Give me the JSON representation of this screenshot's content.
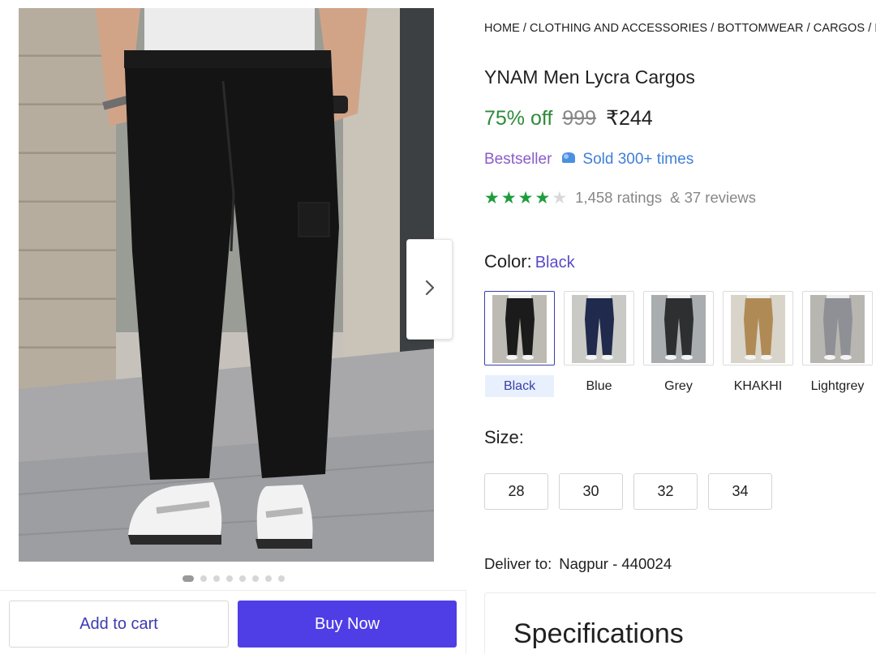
{
  "gallery": {
    "dot_count": 8,
    "active_dot": 0,
    "next_icon": "chevron-right-icon"
  },
  "actions": {
    "add_to_cart": "Add to cart",
    "buy_now": "Buy Now"
  },
  "breadcrumb": {
    "items": [
      "HOME",
      "CLOTHING AND ACCESSORIES",
      "BOTTOMWEAR",
      "CARGOS",
      "ME"
    ],
    "separator": "/"
  },
  "product": {
    "title": "YNAM Men Lycra Cargos",
    "discount": "75% off",
    "mrp": "999",
    "price": "₹244",
    "bestseller": "Bestseller",
    "sold": "Sold 300+ times",
    "rating": 4,
    "rating_max": 5,
    "ratings_text": "1,458 ratings",
    "reviews_text": "& 37 reviews"
  },
  "color": {
    "label": "Color:",
    "selected": "Black",
    "options": [
      {
        "name": "Black",
        "fill": "#1b1b1b",
        "bg": "#bdbab4"
      },
      {
        "name": "Blue",
        "fill": "#1f2a4d",
        "bg": "#c9c9c6"
      },
      {
        "name": "Grey",
        "fill": "#2d2f31",
        "bg": "#a9adaf"
      },
      {
        "name": "KHAKHI",
        "fill": "#b08a55",
        "bg": "#d9d4ca"
      },
      {
        "name": "Lightgrey",
        "fill": "#8e9096",
        "bg": "#b8b6b1"
      }
    ]
  },
  "size": {
    "label": "Size:",
    "options": [
      "28",
      "30",
      "32",
      "34"
    ]
  },
  "delivery": {
    "label": "Deliver to:",
    "location": "Nagpur - 440024"
  },
  "specifications": {
    "title": "Specifications"
  },
  "colors": {
    "accent": "#4f3ee6",
    "discount_green": "#2e8b3a",
    "star_green": "#1e9c3c",
    "bestseller_purple": "#8a5cc9",
    "sold_blue": "#3f7fd8"
  }
}
